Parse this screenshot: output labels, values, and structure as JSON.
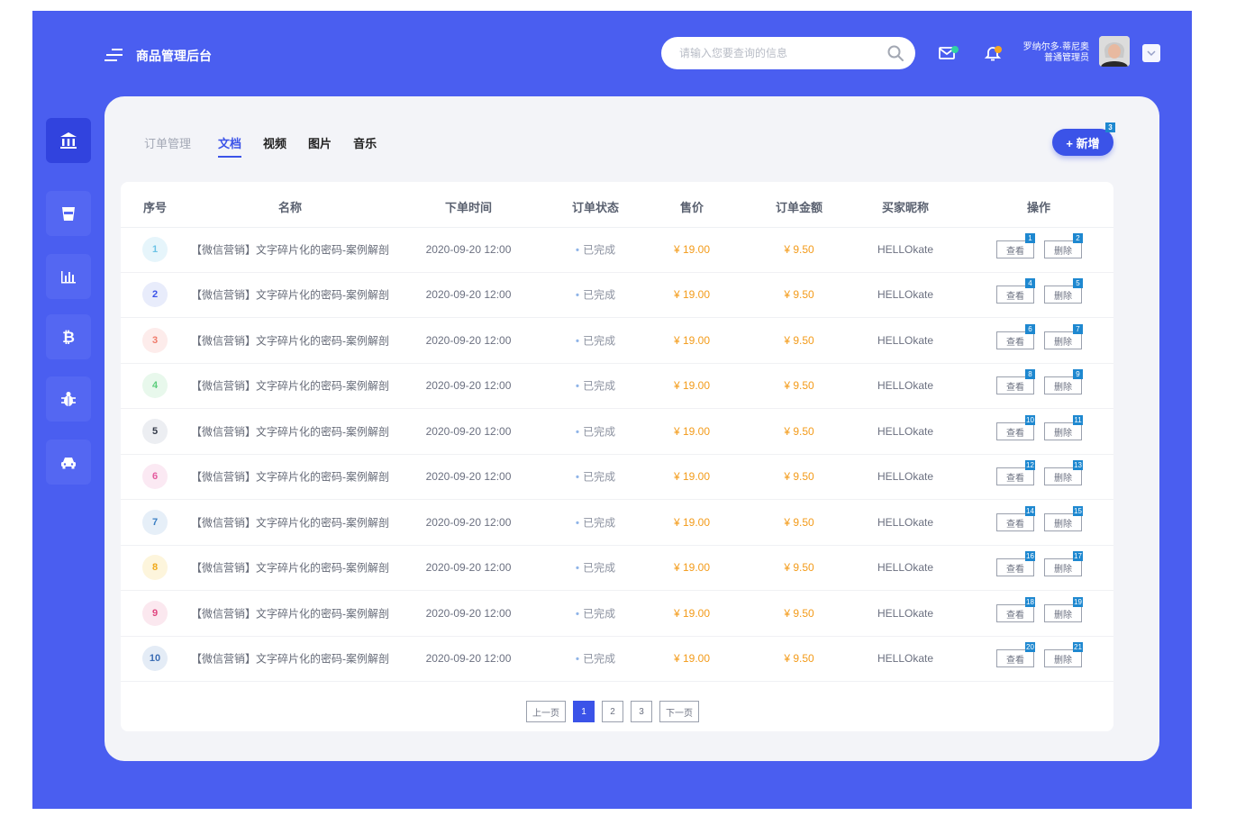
{
  "app": {
    "title": "商品管理后台"
  },
  "search": {
    "placeholder": "请输入您要查询的信息"
  },
  "user": {
    "name": "罗纳尔多·蒂尼奥",
    "role": "普通管理员"
  },
  "tabs": [
    {
      "label": "订单管理",
      "state": "muted"
    },
    {
      "label": "文档",
      "state": "active"
    },
    {
      "label": "视频",
      "state": "normal"
    },
    {
      "label": "图片",
      "state": "normal"
    },
    {
      "label": "音乐",
      "state": "normal"
    }
  ],
  "add_button": {
    "label": "+ 新增",
    "badge": "3"
  },
  "columns": [
    "序号",
    "名称",
    "下单时间",
    "订单状态",
    "售价",
    "订单金额",
    "买家昵称",
    "操作"
  ],
  "rows": [
    {
      "index": "1",
      "name": "【微信营销】文字碎片化的密码-案例解剖",
      "time": "2020-09-20 12:00",
      "status": "已完成",
      "price": "¥ 19.00",
      "amount": "¥ 9.50",
      "buyer": "HELLOkate",
      "view_label": "查看",
      "delete_label": "删除",
      "view_badge": "1",
      "delete_badge": "2"
    },
    {
      "index": "2",
      "name": "【微信营销】文字碎片化的密码-案例解剖",
      "time": "2020-09-20 12:00",
      "status": "已完成",
      "price": "¥ 19.00",
      "amount": "¥ 9.50",
      "buyer": "HELLOkate",
      "view_label": "查看",
      "delete_label": "删除",
      "view_badge": "4",
      "delete_badge": "5"
    },
    {
      "index": "3",
      "name": "【微信营销】文字碎片化的密码-案例解剖",
      "time": "2020-09-20 12:00",
      "status": "已完成",
      "price": "¥ 19.00",
      "amount": "¥ 9.50",
      "buyer": "HELLOkate",
      "view_label": "查看",
      "delete_label": "删除",
      "view_badge": "6",
      "delete_badge": "7"
    },
    {
      "index": "4",
      "name": "【微信营销】文字碎片化的密码-案例解剖",
      "time": "2020-09-20 12:00",
      "status": "已完成",
      "price": "¥ 19.00",
      "amount": "¥ 9.50",
      "buyer": "HELLOkate",
      "view_label": "查看",
      "delete_label": "删除",
      "view_badge": "8",
      "delete_badge": "9"
    },
    {
      "index": "5",
      "name": "【微信营销】文字碎片化的密码-案例解剖",
      "time": "2020-09-20 12:00",
      "status": "已完成",
      "price": "¥ 19.00",
      "amount": "¥ 9.50",
      "buyer": "HELLOkate",
      "view_label": "查看",
      "delete_label": "删除",
      "view_badge": "10",
      "delete_badge": "11"
    },
    {
      "index": "6",
      "name": "【微信营销】文字碎片化的密码-案例解剖",
      "time": "2020-09-20 12:00",
      "status": "已完成",
      "price": "¥ 19.00",
      "amount": "¥ 9.50",
      "buyer": "HELLOkate",
      "view_label": "查看",
      "delete_label": "删除",
      "view_badge": "12",
      "delete_badge": "13"
    },
    {
      "index": "7",
      "name": "【微信营销】文字碎片化的密码-案例解剖",
      "time": "2020-09-20 12:00",
      "status": "已完成",
      "price": "¥ 19.00",
      "amount": "¥ 9.50",
      "buyer": "HELLOkate",
      "view_label": "查看",
      "delete_label": "删除",
      "view_badge": "14",
      "delete_badge": "15"
    },
    {
      "index": "8",
      "name": "【微信营销】文字碎片化的密码-案例解剖",
      "time": "2020-09-20 12:00",
      "status": "已完成",
      "price": "¥ 19.00",
      "amount": "¥ 9.50",
      "buyer": "HELLOkate",
      "view_label": "查看",
      "delete_label": "删除",
      "view_badge": "16",
      "delete_badge": "17"
    },
    {
      "index": "9",
      "name": "【微信营销】文字碎片化的密码-案例解剖",
      "time": "2020-09-20 12:00",
      "status": "已完成",
      "price": "¥ 19.00",
      "amount": "¥ 9.50",
      "buyer": "HELLOkate",
      "view_label": "查看",
      "delete_label": "删除",
      "view_badge": "18",
      "delete_badge": "19"
    },
    {
      "index": "10",
      "name": "【微信营销】文字碎片化的密码-案例解剖",
      "time": "2020-09-20 12:00",
      "status": "已完成",
      "price": "¥ 19.00",
      "amount": "¥ 9.50",
      "buyer": "HELLOkate",
      "view_label": "查看",
      "delete_label": "删除",
      "view_badge": "20",
      "delete_badge": "21"
    }
  ],
  "index_colors": [
    {
      "bg": "#e6f5fb",
      "fg": "#6cc3e6"
    },
    {
      "bg": "#e8ecfb",
      "fg": "#3b53e8"
    },
    {
      "bg": "#fdeceb",
      "fg": "#f07a6a"
    },
    {
      "bg": "#e8f8ec",
      "fg": "#5ccd7c"
    },
    {
      "bg": "#eceef2",
      "fg": "#333a48"
    },
    {
      "bg": "#fbe9f3",
      "fg": "#e45a9e"
    },
    {
      "bg": "#e6eff8",
      "fg": "#3b7fc4"
    },
    {
      "bg": "#fdf5dc",
      "fg": "#f0a91a"
    },
    {
      "bg": "#fbe8ef",
      "fg": "#e0457f"
    },
    {
      "bg": "#e4ecf6",
      "fg": "#3b6db4"
    }
  ],
  "pagination": {
    "prev_label": "上一页",
    "next_label": "下一页",
    "pages": [
      "1",
      "2",
      "3"
    ],
    "current": "1"
  },
  "colors": {
    "primary": "#4a5ef0",
    "accent": "#3b53e8",
    "price": "#f39b1a",
    "badge": "#1e88d0",
    "notify": "#f5a623"
  },
  "icons": {
    "sidebar": [
      "bank-icon",
      "cup-icon",
      "bar-chart-icon",
      "bitcoin-icon",
      "bug-icon",
      "taxi-icon"
    ],
    "header": [
      "menu-icon",
      "search-icon",
      "mail-icon",
      "bell-icon",
      "chevron-down-icon"
    ]
  }
}
